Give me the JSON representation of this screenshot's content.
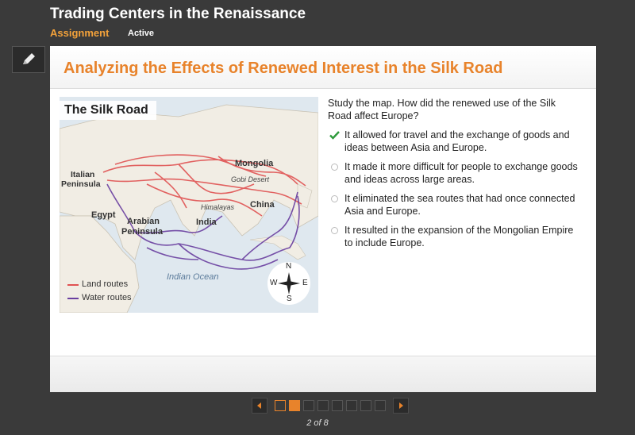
{
  "header": {
    "title": "Trading Centers in the Renaissance",
    "assignment_label": "Assignment",
    "status": "Active"
  },
  "toolbar": {
    "pencil_icon": "pencil-icon"
  },
  "card": {
    "title": "Analyzing the Effects of Renewed Interest in the Silk Road"
  },
  "map": {
    "title": "The Silk Road",
    "labels": {
      "italian": "Italian Peninsula",
      "italian_1": "Italian",
      "italian_2": "Peninsula",
      "egypt": "Egypt",
      "arabian_1": "Arabian",
      "arabian_2": "Peninsula",
      "india": "India",
      "himalayas": "Himalayas",
      "gobi": "Gobi Desert",
      "mongolia": "Mongolia",
      "china": "China",
      "indian_ocean": "Indian Ocean"
    },
    "compass": {
      "n": "N",
      "s": "S",
      "e": "E",
      "w": "W"
    },
    "legend": [
      {
        "label": "Land routes",
        "color": "#e05252"
      },
      {
        "label": "Water routes",
        "color": "#6a3fa0"
      }
    ]
  },
  "question": {
    "text": "Study the map. How did the renewed use of the Silk Road affect Europe?",
    "options": [
      {
        "text": "It allowed for travel and the exchange of goods and ideas between Asia and Europe.",
        "selected": true
      },
      {
        "text": "It made it more difficult for people to exchange goods and ideas across large areas.",
        "selected": false
      },
      {
        "text": "It eliminated the sea routes that had once connected Asia and Europe.",
        "selected": false
      },
      {
        "text": "It resulted in the expansion of the Mongolian Empire to include Europe.",
        "selected": false
      }
    ]
  },
  "pager": {
    "indicator": "2 of 8",
    "total": 8,
    "current": 2,
    "accent": "#e8832b"
  }
}
